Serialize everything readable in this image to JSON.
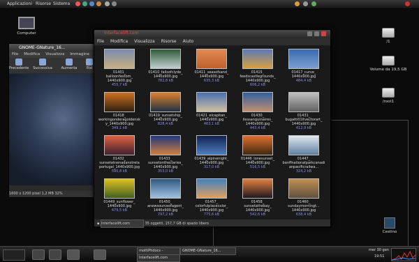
{
  "top_panel": {
    "menus": [
      "Applicazioni",
      "Risorse",
      "Sistema"
    ],
    "clock": "mer 30 gen, 19:51"
  },
  "desktop": {
    "computer": "Computer",
    "drives": [
      {
        "label": "/1"
      },
      {
        "label": "Volume da 19,5 GB"
      },
      {
        "label": "/root1"
      }
    ],
    "trash": "Cestino"
  },
  "viewer": {
    "title": "GNOME-GNature_16...",
    "menus": [
      "File",
      "Modifica",
      "Visualizza",
      "Immagine",
      "Va"
    ],
    "toolbar": [
      "Precedente",
      "Successiva",
      "Aumenta",
      "Rid"
    ],
    "status": "1600 x 1200 pixel  1,2 MB   32%"
  },
  "file_manager": {
    "title": "Interfacelift.com",
    "menus": [
      "File",
      "Modifica",
      "Visualizza",
      "Risorse",
      "Aiuto"
    ],
    "files": [
      {
        "name": "01401_\nballoonfestom_\n1440x900.jpg",
        "size": "455,7 kB",
        "c1": "#7a8ab0",
        "c2": "#c8b080"
      },
      {
        "name": "01410_fallsofclyde_\n1440x900.jpg",
        "size": "782,8 kB",
        "c1": "#2f5a3a",
        "c2": "#c0d0d0"
      },
      {
        "name": "01411_seasofsand_\n1440x900.jpg",
        "size": "635,3 kB",
        "c1": "#e08a50",
        "c2": "#c06030"
      },
      {
        "name": "01415_\nfeedscastlegrounds_\n1440x900.jpg",
        "size": "606,2 kB",
        "c1": "#5a7ab8",
        "c2": "#d8a040"
      },
      {
        "name": "01417_curve_\n1440x900.jpg",
        "size": "484,4 kB",
        "c1": "#3a6ab0",
        "c2": "#7aa0d0"
      },
      {
        "name": "01418_\nworkingonderagoldensk\ny_1440x900.jpg",
        "size": "349,1 kB",
        "c1": "#d07020",
        "c2": "#302010"
      },
      {
        "name": "01419_sunsetship_\n1440x900.jpg",
        "size": "828,4 kB",
        "c1": "#e08030",
        "c2": "#203040"
      },
      {
        "name": "01421_elcapitan_\n1440x900.jpg",
        "size": "463,1 kB",
        "c1": "#4a70b0",
        "c2": "#d0c0a0"
      },
      {
        "name": "01430_\nilessanguinaires_\n1440x900.jpg",
        "size": "443,4 kB",
        "c1": "#3060a0",
        "c2": "#c09070"
      },
      {
        "name": "01431_\nbugatti01ltvectorart_\n1440x900.jpg",
        "size": "412,9 kB",
        "c1": "#c0c0c0",
        "c2": "#606060"
      },
      {
        "name": "01432_\nsunsetatnenadanstrela\nportugal_1440x900.jpg",
        "size": "590,8 kB",
        "c1": "#e06040",
        "c2": "#402030"
      },
      {
        "name": "01433_\nsunsetontheclaries_\n1440x900.jpg",
        "size": "353,0 kB",
        "c1": "#203880",
        "c2": "#d08040"
      },
      {
        "name": "01439_alpinenight_\n1440x900.jpg",
        "size": "317,0 kB",
        "c1": "#102050",
        "c2": "#5080c0"
      },
      {
        "name": "01446_lonesunset_\n1440x900.jpg",
        "size": "516,5 kB",
        "c1": "#e07030",
        "c2": "#402810"
      },
      {
        "name": "01447_\nbanffnationalparkcanadi\nanpacificrailwa...",
        "size": "324,2 kB",
        "c1": "#e0e8f0",
        "c2": "#6080a0"
      },
      {
        "name": "01449_sunflower_\n1440x900.jpg",
        "size": "479,5 kB",
        "c1": "#e0c020",
        "c2": "#406020"
      },
      {
        "name": "01450_\nanewsourceofagent_\n1440x900.jpg",
        "size": "797,2 kB",
        "c1": "#305880",
        "c2": "#a0c0e0"
      },
      {
        "name": "01457_\ncolorfulplacecolor_\n1440x900.jpg",
        "size": "775,6 kB",
        "c1": "#4080c0",
        "c2": "#e0a060"
      },
      {
        "name": "01458_\nsunsetathebay_\n1440x900.jpg",
        "size": "542,6 kB",
        "c1": "#e08040",
        "c2": "#201820"
      },
      {
        "name": "01460_\nsundaymorningt...\n1440x900.jpg",
        "size": "638,4 kB",
        "c1": "#c09050",
        "c2": "#605040"
      }
    ],
    "status_folder": "Interfacelift.com",
    "status": "35 oggetti, 157,7 GB di spazio libero"
  },
  "taskbar": {
    "items": [
      "mottiPhdocs -",
      "Interfacelift.com",
      "GNOME-GNature_16..."
    ],
    "clock_day": "mer 30 gen",
    "clock_time": "19:51"
  }
}
